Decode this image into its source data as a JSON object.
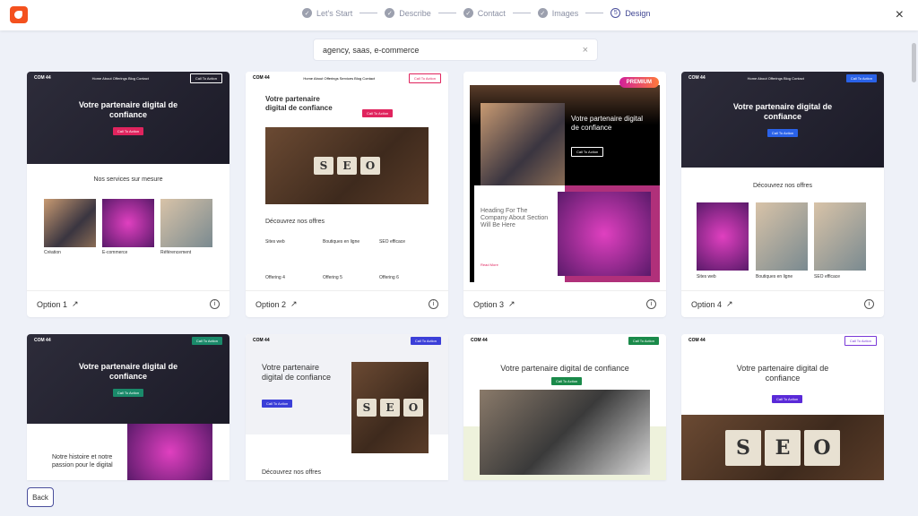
{
  "header": {
    "steps": [
      {
        "label": "Let's Start",
        "state": "done"
      },
      {
        "label": "Describe",
        "state": "done"
      },
      {
        "label": "Contact",
        "state": "done"
      },
      {
        "label": "Images",
        "state": "done"
      },
      {
        "label": "Design",
        "number": "5",
        "state": "current"
      }
    ],
    "close": "×"
  },
  "search": {
    "value": "agency, saas, e-commerce",
    "clear": "×"
  },
  "options": [
    {
      "label": "Option 1",
      "brand": "COM 44",
      "nav": "Home  About  Offerings  Blog  Contact",
      "cta": "Call To Action",
      "hero": "Votre partenaire digital de confiance",
      "section": "Nos services sur mesure",
      "items": [
        "Création",
        "E-commerce",
        "Référencement"
      ]
    },
    {
      "label": "Option 2",
      "brand": "COM 44",
      "nav": "Home  About  Offerings  Services  Blog  Contact",
      "cta": "Call To Action",
      "hero": "Votre partenaire digital de confiance",
      "section": "Découvrez nos offres",
      "items": [
        "Sites web",
        "Boutiques en ligne",
        "SEO efficace",
        "Offering 4",
        "Offering 5",
        "Offering 6"
      ]
    },
    {
      "label": "Option 3",
      "badge": "PREMIUM",
      "hero": "Votre partenaire digital de confiance",
      "cta": "Call To Action",
      "section": "Heading For The Company About Section Will Be Here",
      "more": "Read More"
    },
    {
      "label": "Option 4",
      "brand": "COM 44",
      "nav": "Home  About  Offerings  Blog  Contact",
      "cta": "Call To Action",
      "hero": "Votre partenaire digital de confiance",
      "section": "Découvrez nos offres",
      "items": [
        "Sites web",
        "Boutiques en ligne",
        "SEO efficace"
      ]
    },
    {
      "brand": "COM 44",
      "cta": "Call To Action",
      "hero": "Votre partenaire digital de confiance",
      "section": "Notre histoire et notre passion pour le digital"
    },
    {
      "brand": "COM 44",
      "cta": "Call To Action",
      "hero": "Votre partenaire digital de confiance",
      "section": "Découvrez nos offres"
    },
    {
      "brand": "COM 44",
      "cta": "Call To Action",
      "hero": "Votre partenaire digital de confiance"
    },
    {
      "brand": "COM 44",
      "cta": "Call To Action",
      "hero": "Votre partenaire digital de confiance"
    }
  ],
  "back": "Back"
}
